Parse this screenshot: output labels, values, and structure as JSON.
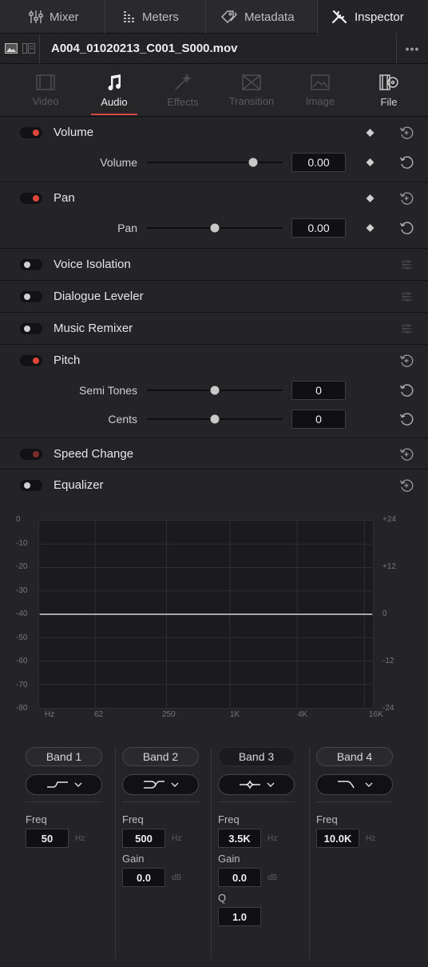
{
  "top_tabs": [
    {
      "label": "Mixer",
      "icon": "mixer-icon"
    },
    {
      "label": "Meters",
      "icon": "meters-icon"
    },
    {
      "label": "Metadata",
      "icon": "metadata-icon"
    },
    {
      "label": "Inspector",
      "icon": "inspector-icon"
    }
  ],
  "clip": {
    "title": "A004_01020213_C001_S000.mov",
    "more": "•••"
  },
  "inspector_tabs": [
    {
      "label": "Video"
    },
    {
      "label": "Audio"
    },
    {
      "label": "Effects"
    },
    {
      "label": "Transition"
    },
    {
      "label": "Image"
    },
    {
      "label": "File"
    }
  ],
  "volume": {
    "title": "Volume",
    "param_label": "Volume",
    "value": "0.00",
    "slider": 0.78
  },
  "pan": {
    "title": "Pan",
    "param_label": "Pan",
    "value": "0.00",
    "slider": 0.5
  },
  "voice_isolation": {
    "title": "Voice Isolation"
  },
  "dialogue_leveler": {
    "title": "Dialogue Leveler"
  },
  "music_remixer": {
    "title": "Music Remixer"
  },
  "pitch": {
    "title": "Pitch",
    "semi_label": "Semi Tones",
    "semi_value": "0",
    "semi_slider": 0.5,
    "cents_label": "Cents",
    "cents_value": "0",
    "cents_slider": 0.5
  },
  "speed_change": {
    "title": "Speed Change"
  },
  "equalizer": {
    "title": "Equalizer",
    "left_axis": [
      "0",
      "-10",
      "-20",
      "-30",
      "-40",
      "-50",
      "-60",
      "-70",
      "-80"
    ],
    "right_axis": [
      "+24",
      "+12",
      "0",
      "-12",
      "-24"
    ],
    "freq_axis": [
      "Hz",
      "62",
      "250",
      "1K",
      "4K",
      "16K"
    ],
    "bands": [
      {
        "name": "Band 1",
        "freq_label": "Freq",
        "freq": "50",
        "freq_unit": "Hz",
        "shape_icon": "low-shelf-icon"
      },
      {
        "name": "Band 2",
        "freq_label": "Freq",
        "freq": "500",
        "freq_unit": "Hz",
        "gain_label": "Gain",
        "gain": "0.0",
        "gain_unit": "dB",
        "shape_icon": "bell-icon"
      },
      {
        "name": "Band 3",
        "freq_label": "Freq",
        "freq": "3.5K",
        "freq_unit": "Hz",
        "gain_label": "Gain",
        "gain": "0.0",
        "gain_unit": "dB",
        "q_label": "Q",
        "q": "1.0",
        "shape_icon": "notch-icon"
      },
      {
        "name": "Band 4",
        "freq_label": "Freq",
        "freq": "10.0K",
        "freq_unit": "Hz",
        "shape_icon": "high-cut-icon"
      }
    ]
  }
}
